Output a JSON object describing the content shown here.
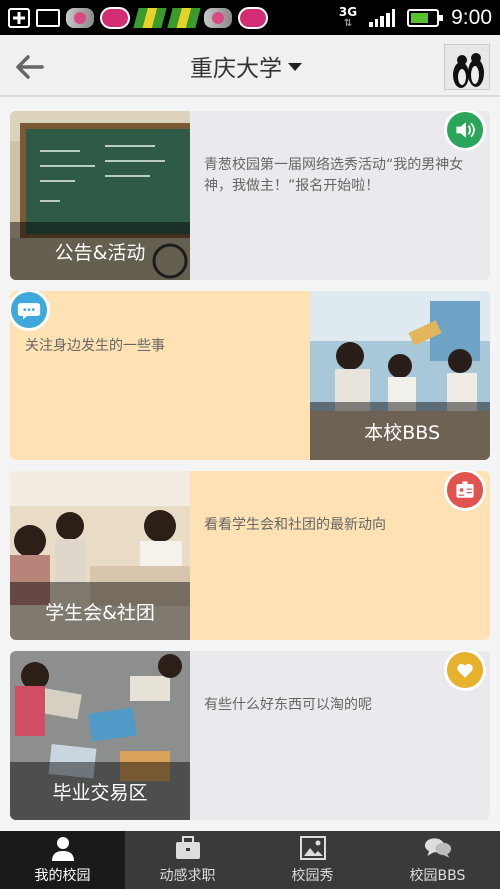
{
  "status_bar": {
    "network": "3G",
    "time": "9:00"
  },
  "header": {
    "title": "重庆大学"
  },
  "cards": [
    {
      "label": "公告&活动",
      "text": "青葱校园第一届网络选秀活动“我的男神女神，我做主！”报名开始啦！",
      "badge_icon": "speaker-icon",
      "badge_color": "#2aa55a"
    },
    {
      "label": "本校BBS",
      "text": "关注身边发生的一些事",
      "badge_icon": "chat-icon",
      "badge_color": "#3fa8dc"
    },
    {
      "label": "学生会&社团",
      "text": "看看学生会和社团的最新动向",
      "badge_icon": "id-card-icon",
      "badge_color": "#e0534f"
    },
    {
      "label": "毕业交易区",
      "text": "有些什么好东西可以淘的呢",
      "badge_icon": "heart-icon",
      "badge_color": "#e6b12d"
    }
  ],
  "bottom_nav": [
    {
      "label": "我的校园",
      "active": true
    },
    {
      "label": "动感求职",
      "active": false
    },
    {
      "label": "校园秀",
      "active": false
    },
    {
      "label": "校园BBS",
      "active": false
    }
  ]
}
